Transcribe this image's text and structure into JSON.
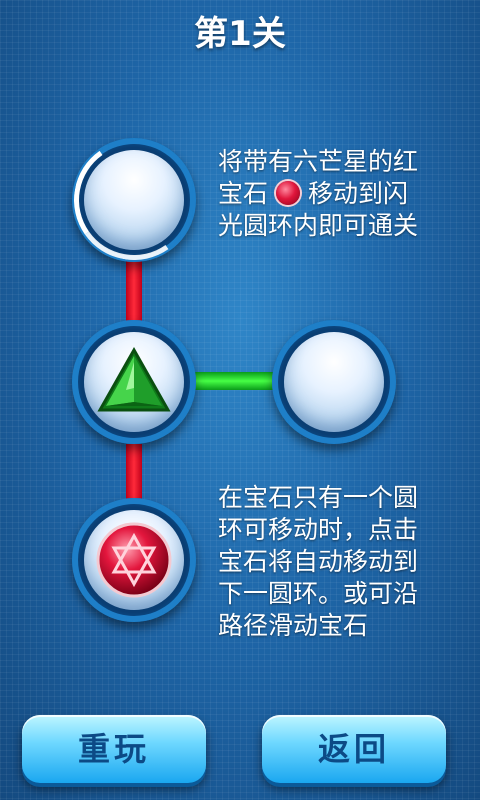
{
  "header": {
    "title": "第1关"
  },
  "hints": {
    "goal_before": "将带有六芒星的红宝石",
    "goal_after": "移动到闪光圆环内即可通关",
    "instruction": "在宝石只有一个圆环可移动时，点击宝石将自动移动到下一圆环。或可沿路径滑动宝石"
  },
  "board": {
    "nodes": [
      {
        "id": "top",
        "content": "empty",
        "highlighted_target": true
      },
      {
        "id": "middle",
        "content": "green-triangle-gem"
      },
      {
        "id": "right",
        "content": "empty"
      },
      {
        "id": "bottom",
        "content": "red-hexagram-ruby"
      }
    ],
    "links": [
      {
        "from": "top",
        "to": "middle",
        "color": "red"
      },
      {
        "from": "middle",
        "to": "right",
        "color": "green"
      },
      {
        "from": "middle",
        "to": "bottom",
        "color": "red"
      }
    ]
  },
  "footer": {
    "replay_label": "重玩",
    "back_label": "返回"
  },
  "colors": {
    "background": "#1e66a8",
    "red_link": "#ff2a3a",
    "green_link": "#46ff45",
    "button": "#6fd8ff"
  }
}
